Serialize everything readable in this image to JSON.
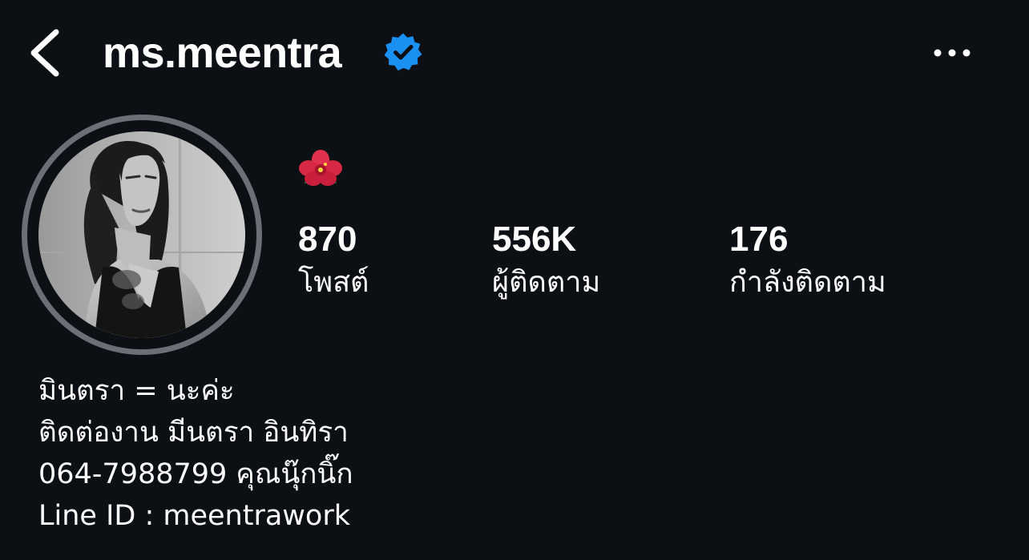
{
  "header": {
    "username": "ms.meentra",
    "verified": true,
    "back_icon": "chevron-left-icon",
    "more_icon": "more-horizontal-icon",
    "verified_icon": "verified-badge-icon",
    "verified_color": "#1a91f2"
  },
  "profile": {
    "avatar_icon": "profile-photo",
    "avatar_ring_color": "#6a6f78",
    "note_emoji": "🌺"
  },
  "stats": [
    {
      "value": "870",
      "label": "โพสต์"
    },
    {
      "value": "556K",
      "label": "ผู้ติดตาม"
    },
    {
      "value": "176",
      "label": "กำลังติดตาม"
    }
  ],
  "bio": {
    "lines": [
      "มินตรา = นะค่ะ",
      "ติดต่องาน มีนตรา อินทิรา",
      "064-7988799 คุณนุ๊กนิ๊ก",
      "Line ID : meentrawork"
    ]
  },
  "theme": {
    "background": "#0c0f14",
    "text": "#ffffff"
  }
}
